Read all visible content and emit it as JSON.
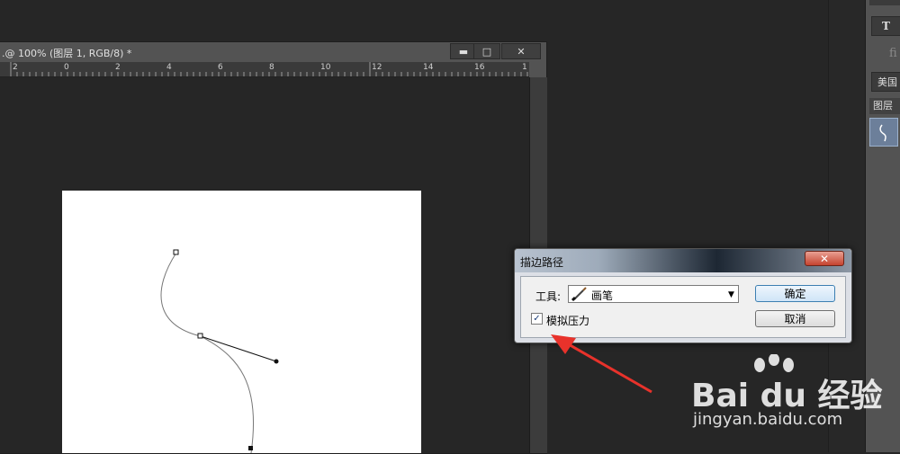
{
  "document": {
    "title": ".@ 100% (图层 1, RGB/8) *",
    "minimize": "▬",
    "maximize": "□",
    "close": "✕",
    "ruler_labels": [
      "2",
      "0",
      "2",
      "4",
      "6",
      "8",
      "10",
      "12",
      "14",
      "16",
      "1"
    ]
  },
  "right_panel": {
    "type_tool": "T",
    "ligature": "fi",
    "language": "美国",
    "layers_tab": "图层"
  },
  "dialog": {
    "title": "描边路径",
    "tool_label": "工具:",
    "tool_value": "画笔",
    "ok": "确定",
    "cancel": "取消",
    "simulate_pressure_label": "模拟压力",
    "simulate_pressure_checked": true
  },
  "watermark": {
    "brand": "Bai du 经验",
    "url": "jingyan.baidu.com"
  },
  "colors": {
    "arrow": "#e8322b",
    "canvas": "#ffffff",
    "workspace": "#262626"
  }
}
